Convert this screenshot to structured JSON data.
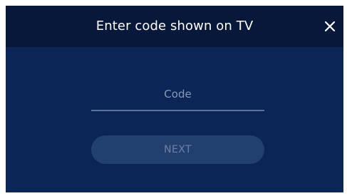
{
  "dialog": {
    "title": "Enter code shown on TV",
    "close_icon": "close-icon",
    "code_field": {
      "value": "",
      "placeholder": "Code"
    },
    "next_label": "NEXT"
  },
  "colors": {
    "header_bg": "#08183a",
    "panel_bg": "#0b2656",
    "button_bg": "#22406f",
    "button_text": "#6f81a6",
    "placeholder": "#8a98b8",
    "underline": "#5f7196",
    "title_text": "#ffffff"
  }
}
